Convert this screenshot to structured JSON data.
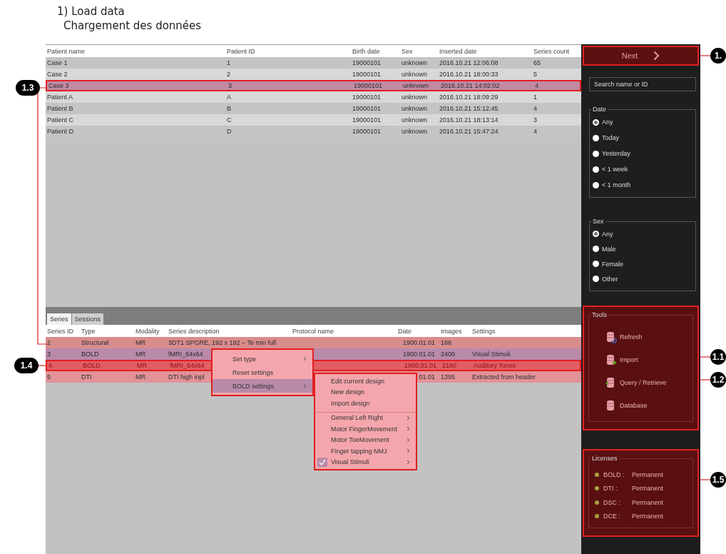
{
  "title": "1) Load data",
  "subtitle": "Chargement des données",
  "patients": {
    "columns": [
      "Patient name",
      "Patient ID",
      "Birth date",
      "Sex",
      "Inserted date",
      "Series count"
    ],
    "rows": [
      {
        "cells": [
          "Case 1",
          "1",
          "19000101",
          "unknown",
          "2016.10.21 12:06:08",
          "65"
        ],
        "selected": false
      },
      {
        "cells": [
          "Case 2",
          "2",
          "19000101",
          "unknown",
          "2016.10.21 18:00:33",
          "5"
        ],
        "selected": false
      },
      {
        "cells": [
          "Case 3",
          "3",
          "19000101",
          "unknown",
          "2016.10.21 14:02:02",
          "4"
        ],
        "selected": true
      },
      {
        "cells": [
          "Patient A",
          "A",
          "19000101",
          "unknown",
          "2016.10.21 18:09:29",
          "1"
        ],
        "selected": false
      },
      {
        "cells": [
          "Patient B",
          "B",
          "19000101",
          "unknown",
          "2016.10.21 15:12:45",
          "4"
        ],
        "selected": false
      },
      {
        "cells": [
          "Patient C",
          "C",
          "19000101",
          "unknown",
          "2016.10.21 18:13:14",
          "3"
        ],
        "selected": false
      },
      {
        "cells": [
          "Patient D",
          "D",
          "19000101",
          "unknown",
          "2016.10.21 15:47:24",
          "4"
        ],
        "selected": false
      }
    ]
  },
  "tabs": [
    {
      "label": "Series",
      "selected": true
    },
    {
      "label": "Sessions",
      "selected": false
    }
  ],
  "series": {
    "columns": [
      "Series ID",
      "Type",
      "Modality",
      "Series description",
      "Protocol name",
      "Date",
      "Images",
      "Settings"
    ],
    "rows": [
      {
        "id": "2",
        "type": "Structural",
        "modality": "MR",
        "description": "3DT1 SPGRE, 192 x 192 – Te min full",
        "date": "1900.01.01",
        "images": "188",
        "color": "#d98c8c",
        "selected": false
      },
      {
        "id": "3",
        "type": "BOLD",
        "modality": "MR",
        "description": "fMRI_64x64",
        "date": "1900.01.01",
        "images": "2400",
        "settings": "Visual Stimuli",
        "color": "#b98aaa",
        "selected": false
      },
      {
        "id": "4",
        "type": "BOLD",
        "modality": "MR",
        "description": "fMRI_64x64",
        "date": "1900.01.01",
        "images": "2160",
        "settings": "Auditory Tones",
        "color": "#e25c62",
        "selected": true
      },
      {
        "id": "5",
        "type": "DTI",
        "modality": "MR",
        "description": "DTI high inpl",
        "date": "01.01",
        "images": "1395",
        "settings": "Extracted from header",
        "color": "#e29298",
        "selected": false
      }
    ]
  },
  "context_menu": [
    {
      "label": "Set type",
      "submenu": true,
      "selected": false
    },
    {
      "label": "Reset settings",
      "submenu": false,
      "selected": false
    },
    {
      "label": "BOLD settings",
      "submenu": true,
      "selected": true
    }
  ],
  "submenu": [
    {
      "label": "Edit current design",
      "submenu": false,
      "checked": false,
      "separator_before": false
    },
    {
      "label": "New design",
      "submenu": false,
      "checked": false,
      "separator_before": false
    },
    {
      "label": "Import design",
      "submenu": false,
      "checked": false,
      "separator_before": false
    },
    {
      "label": "General Left Right",
      "submenu": true,
      "checked": false,
      "separator_before": true
    },
    {
      "label": "Motor FingerMovement",
      "submenu": true,
      "checked": false,
      "separator_before": false
    },
    {
      "label": "Motor ToeMovement",
      "submenu": true,
      "checked": false,
      "separator_before": false
    },
    {
      "label": "Finger tapping NMJ",
      "submenu": true,
      "checked": false,
      "separator_before": false
    },
    {
      "label": "Visual Stimuli",
      "submenu": true,
      "checked": true,
      "separator_before": false
    }
  ],
  "next_button": "Next",
  "search": {
    "placeholder": "Search name or ID"
  },
  "filters": [
    {
      "title": "Date",
      "options": [
        {
          "label": "Any",
          "selected": true
        },
        {
          "label": "Today",
          "selected": false
        },
        {
          "label": "Yesterday",
          "selected": false
        },
        {
          "label": "< 1 week",
          "selected": false
        },
        {
          "label": "< 1 month",
          "selected": false
        }
      ]
    },
    {
      "title": "Sex",
      "options": [
        {
          "label": "Any",
          "selected": true
        },
        {
          "label": "Male",
          "selected": false
        },
        {
          "label": "Female",
          "selected": false
        },
        {
          "label": "Other",
          "selected": false
        }
      ]
    }
  ],
  "tools": {
    "title": "Tools",
    "items": [
      {
        "label": "Refresh",
        "kind": "refresh"
      },
      {
        "label": "Import",
        "kind": "import"
      },
      {
        "label": "Query / Retrieve",
        "kind": "query"
      },
      {
        "label": "Database",
        "kind": "database"
      }
    ]
  },
  "licenses": {
    "title": "Licenses",
    "items": [
      {
        "name": "BOLD :",
        "status": "Permanent"
      },
      {
        "name": "DTI :",
        "status": "Permanent"
      },
      {
        "name": "DSC :",
        "status": "Permanent"
      },
      {
        "name": "DCE :",
        "status": "Permanent"
      }
    ]
  },
  "callouts": [
    {
      "label": "1.3"
    },
    {
      "label": "1.4"
    },
    {
      "label": "1."
    },
    {
      "label": "1.1"
    },
    {
      "label": "1.2"
    },
    {
      "label": "1.5"
    }
  ]
}
